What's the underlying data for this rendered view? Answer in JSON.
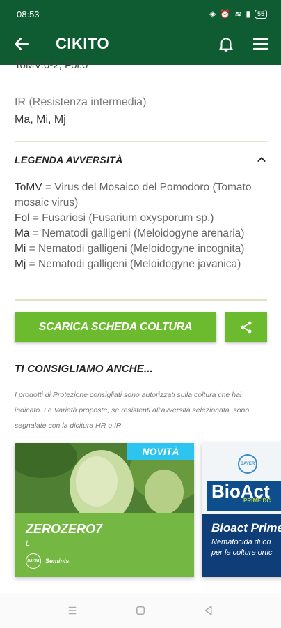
{
  "status_bar": {
    "time": "08:53",
    "battery": "55"
  },
  "app_bar": {
    "title": "CIKITO",
    "icons": [
      "back-arrow-icon",
      "bell-icon",
      "menu-icon"
    ]
  },
  "content": {
    "cut_text": "ToMV:0-2, Fol:0",
    "ir_label": "IR (Resistenza intermedia)",
    "ir_value": "Ma, Mi, Mj",
    "legend_title": "LEGENDA AVVERSITÀ",
    "legend_items": [
      {
        "abbr": "ToMV",
        "desc": " = Virus del Mosaico del Pomodoro (Tomato mosaic virus)"
      },
      {
        "abbr": "Fol",
        "desc": " = Fusariosi (Fusarium oxysporum sp.)"
      },
      {
        "abbr": "Ma",
        "desc": " = Nematodi galligeni (Meloidogyne arenaria)"
      },
      {
        "abbr": "Mi",
        "desc": " = Nematodi galligeni (Meloidogyne incognita)"
      },
      {
        "abbr": "Mj",
        "desc": " = Nematodi galligeni (Meloidogyne javanica)"
      }
    ],
    "download_button": "SCARICA SCHEDA COLTURA",
    "recommend_title": "TI CONSIGLIAMO ANCHE...",
    "recommend_desc": "I prodotti di Protezione consigliati sono autorizzati sulla coltura che hai indicato. Le Varietà proposte, se resistenti all'avversità selezionata, sono segnalate con la dicitura HR o IR."
  },
  "cards": [
    {
      "badge": "NOVITÀ",
      "name": "ZEROZERO7",
      "sub": "L",
      "logo_text": "Seminis",
      "seal_text": "BAYER"
    },
    {
      "brand": "BioAct",
      "brand_sub": "PRIME DC",
      "seal_text": "BAYER",
      "name": "Bioact Prime",
      "desc_line1": "Nematocida di ori",
      "desc_line2": "per le colture ortic"
    }
  ],
  "colors": {
    "header": "#0f5c33",
    "accent_green": "#6cbb2f",
    "badge_blue": "#2ec4f0",
    "bioact_blue": "#0f3d78"
  }
}
